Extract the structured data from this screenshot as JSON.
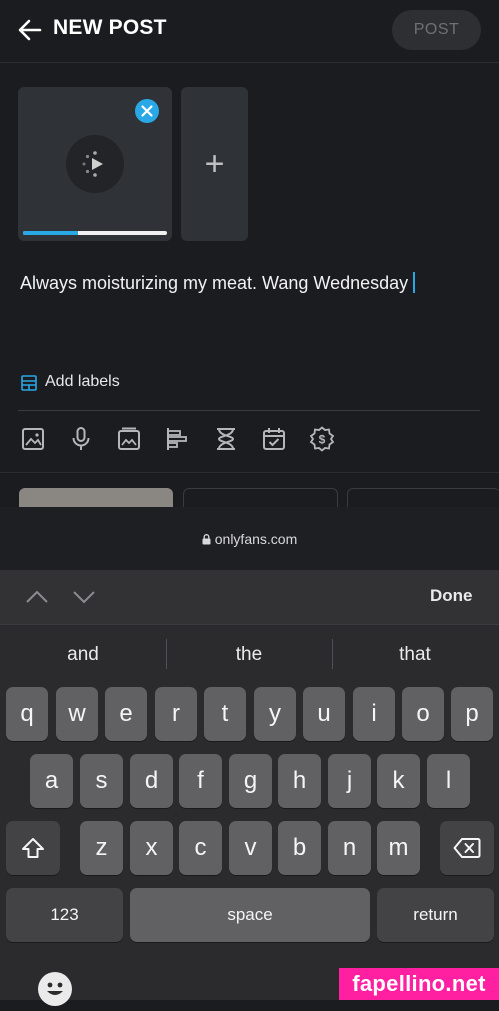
{
  "header": {
    "title": "NEW POST",
    "post_label": "POST"
  },
  "media": {
    "upload_progress": 0.38,
    "add_label": "+"
  },
  "caption": {
    "text": "Always moisturizing my meat. Wang Wednesday"
  },
  "labels": {
    "add_label": "Add labels"
  },
  "toolbar": {
    "icons": [
      "image-icon",
      "microphone-icon",
      "gallery-icon",
      "poll-icon",
      "hourglass-icon",
      "calendar-check-icon",
      "price-badge-icon"
    ]
  },
  "browser": {
    "url": "onlyfans.com"
  },
  "keyboard": {
    "done_label": "Done",
    "suggestions": [
      "and",
      "the",
      "that"
    ],
    "row1": [
      "q",
      "w",
      "e",
      "r",
      "t",
      "y",
      "u",
      "i",
      "o",
      "p"
    ],
    "row2": [
      "a",
      "s",
      "d",
      "f",
      "g",
      "h",
      "j",
      "k",
      "l"
    ],
    "row3": [
      "z",
      "x",
      "c",
      "v",
      "b",
      "n",
      "m"
    ],
    "numbers_label": "123",
    "space_label": "space",
    "return_label": "return"
  },
  "watermark": "fapellino.net",
  "colors": {
    "accent": "#2aa8e6",
    "background": "#1b1c1f",
    "watermark": "#ff1fa1"
  }
}
